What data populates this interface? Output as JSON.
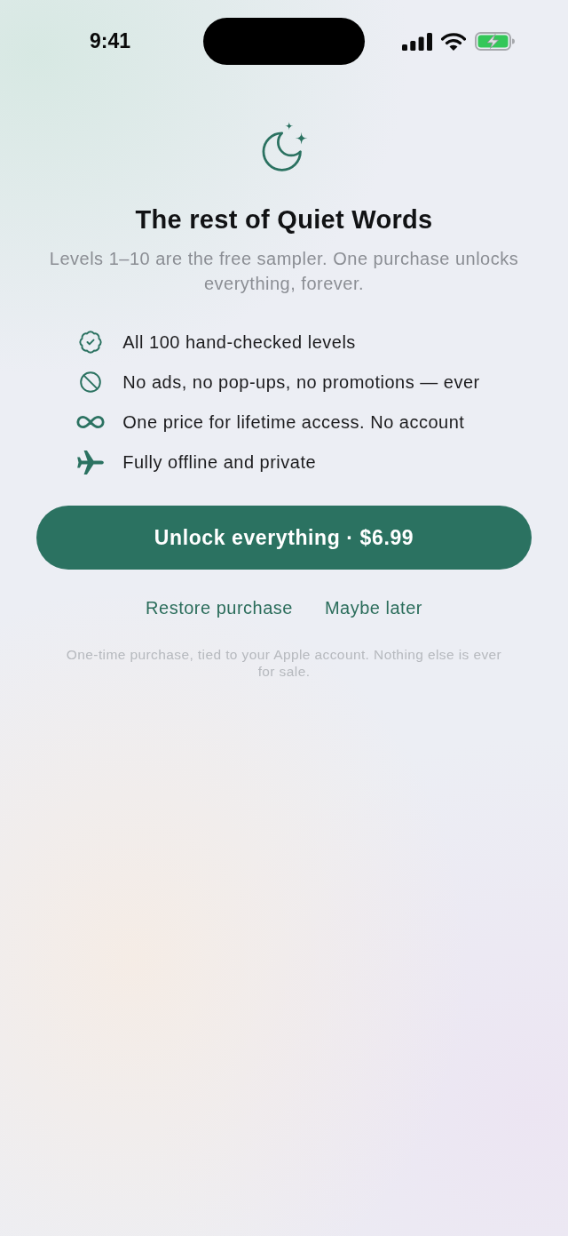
{
  "status_bar": {
    "time": "9:41"
  },
  "header": {
    "title": "The rest of Quiet Words",
    "subtitle": "Levels 1–10 are the free sampler. One purchase unlocks everything, forever."
  },
  "features": [
    {
      "kind": "verified",
      "text": "All 100 hand-checked levels"
    },
    {
      "kind": "no-ads",
      "text": "No ads, no pop-ups, no promotions — ever"
    },
    {
      "kind": "lifetime",
      "text": "One price for lifetime access. No account"
    },
    {
      "kind": "offline",
      "text": "Fully offline and private"
    }
  ],
  "primary_button": {
    "label": "Unlock everything · $6.99"
  },
  "links": [
    {
      "label": "Restore purchase"
    },
    {
      "label": "Maybe later"
    }
  ],
  "footnote": "One-time purchase, tied to your Apple account. Nothing else is ever for sale."
}
